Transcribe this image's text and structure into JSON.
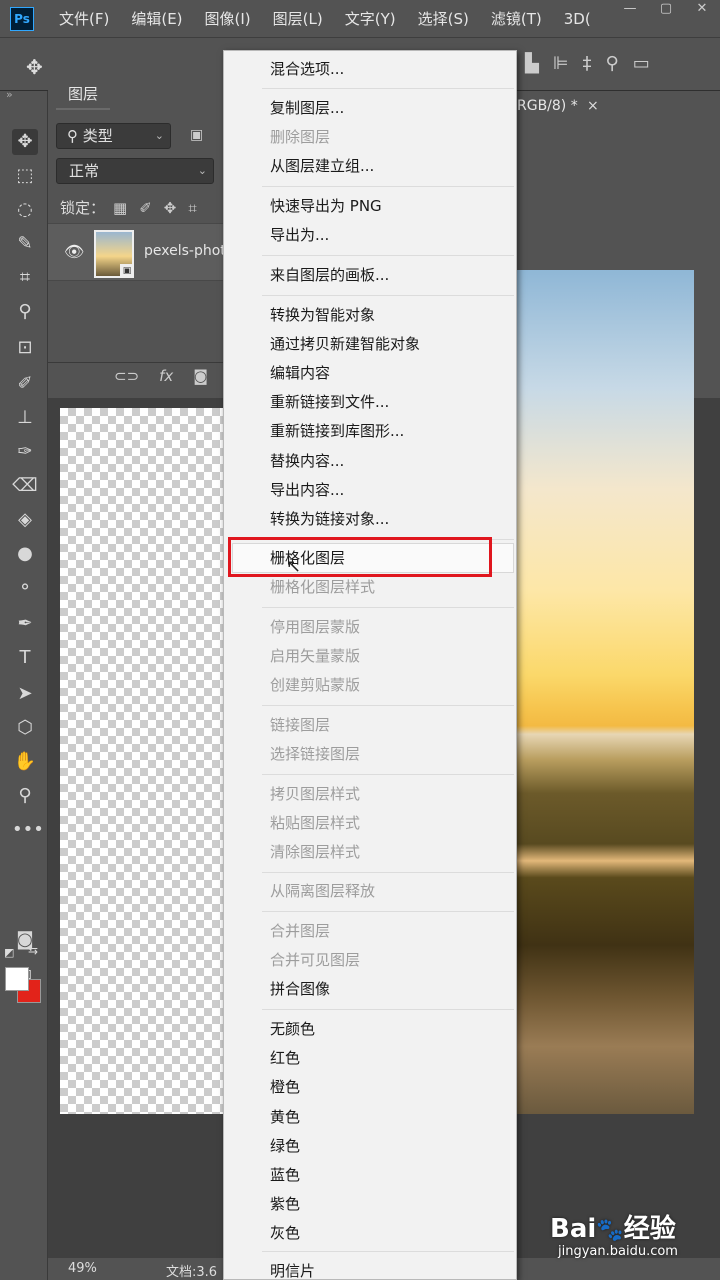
{
  "app": {
    "logo": "Ps"
  },
  "menubar": {
    "items": [
      "文件(F)",
      "编辑(E)",
      "图像(I)",
      "图层(L)",
      "文字(Y)",
      "选择(S)",
      "滤镜(T)",
      "3D("
    ],
    "window_controls": [
      "minimize-icon",
      "restore-icon",
      "close-icon"
    ]
  },
  "optionsbar": {
    "icons": [
      "move-icon",
      "align-bottom-icon",
      "align-left-icon",
      "align-center-icon",
      "search-icon",
      "workspace-icon"
    ]
  },
  "document": {
    "tab_label": "RGB/8) *",
    "close": "×"
  },
  "layers_panel": {
    "tab": "图层",
    "filter_label": "类型",
    "blend_mode": "正常",
    "lock_label": "锁定：",
    "layer_name": "pexels-phot",
    "bottom_icons": [
      "link-icon",
      "fx-icon",
      "mask-icon"
    ],
    "fx_text": "fx"
  },
  "status": {
    "zoom": "49%",
    "doc_info": "文档:3.6"
  },
  "context_menu": {
    "items": [
      {
        "label": "混合选项...",
        "enabled": true
      },
      {
        "label": "复制图层...",
        "enabled": true
      },
      {
        "label": "删除图层",
        "enabled": false
      },
      {
        "label": "从图层建立组...",
        "enabled": true
      },
      {
        "label": "快速导出为 PNG",
        "enabled": true
      },
      {
        "label": "导出为...",
        "enabled": true
      },
      {
        "label": "来自图层的画板...",
        "enabled": true
      },
      {
        "label": "转换为智能对象",
        "enabled": true
      },
      {
        "label": "通过拷贝新建智能对象",
        "enabled": true
      },
      {
        "label": "编辑内容",
        "enabled": true
      },
      {
        "label": "重新链接到文件...",
        "enabled": true
      },
      {
        "label": "重新链接到库图形...",
        "enabled": true
      },
      {
        "label": "替换内容...",
        "enabled": true
      },
      {
        "label": "导出内容...",
        "enabled": true
      },
      {
        "label": "转换为链接对象...",
        "enabled": true
      },
      {
        "label": "栅格化图层",
        "enabled": true,
        "highlighted": true
      },
      {
        "label": "栅格化图层样式",
        "enabled": false
      },
      {
        "label": "停用图层蒙版",
        "enabled": false
      },
      {
        "label": "启用矢量蒙版",
        "enabled": false
      },
      {
        "label": "创建剪贴蒙版",
        "enabled": false
      },
      {
        "label": "链接图层",
        "enabled": false
      },
      {
        "label": "选择链接图层",
        "enabled": false
      },
      {
        "label": "拷贝图层样式",
        "enabled": false
      },
      {
        "label": "粘贴图层样式",
        "enabled": false
      },
      {
        "label": "清除图层样式",
        "enabled": false
      },
      {
        "label": "从隔离图层释放",
        "enabled": false
      },
      {
        "label": "合并图层",
        "enabled": false
      },
      {
        "label": "合并可见图层",
        "enabled": false
      },
      {
        "label": "拼合图像",
        "enabled": true
      },
      {
        "label": "无颜色",
        "enabled": true
      },
      {
        "label": "红色",
        "enabled": true
      },
      {
        "label": "橙色",
        "enabled": true
      },
      {
        "label": "黄色",
        "enabled": true
      },
      {
        "label": "绿色",
        "enabled": true
      },
      {
        "label": "蓝色",
        "enabled": true
      },
      {
        "label": "紫色",
        "enabled": true
      },
      {
        "label": "灰色",
        "enabled": true
      },
      {
        "label": "明信片",
        "enabled": true
      }
    ],
    "highlight_color": "#e0161e"
  },
  "watermark": {
    "brand_top": "Bai",
    "brand_paw": "🐾",
    "brand_cn": "经验",
    "url": "jingyan.baidu.com"
  },
  "colors": {
    "foreground": "#ffffff",
    "background": "#e2231a"
  }
}
